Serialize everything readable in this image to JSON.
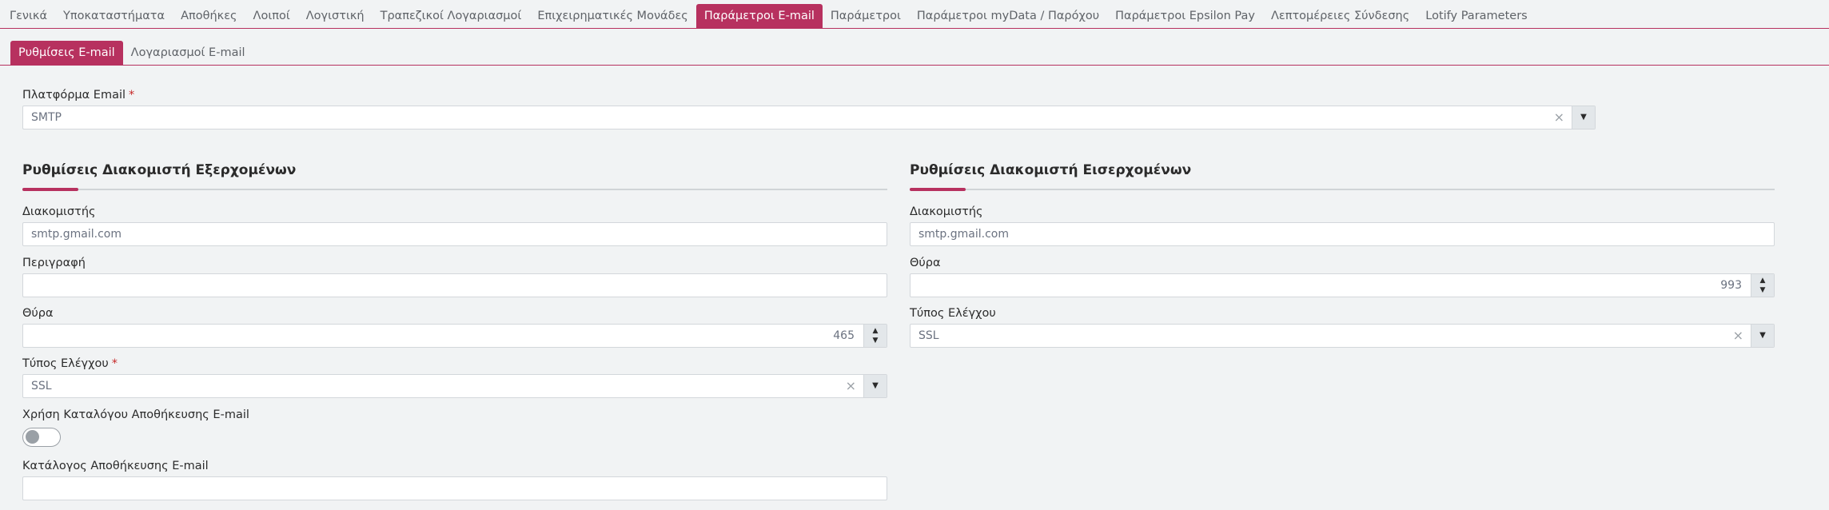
{
  "top_tabs": [
    {
      "label": "Γενικά"
    },
    {
      "label": "Υποκαταστήματα"
    },
    {
      "label": "Αποθήκες"
    },
    {
      "label": "Λοιποί"
    },
    {
      "label": "Λογιστική"
    },
    {
      "label": "Τραπεζικοί Λογαριασμοί"
    },
    {
      "label": "Επιχειρηματικές Μονάδες"
    },
    {
      "label": "Παράμετροι E-mail",
      "active": true
    },
    {
      "label": "Παράμετροι"
    },
    {
      "label": "Παράμετροι myData / Παρόχου"
    },
    {
      "label": "Παράμετροι Epsilon Pay"
    },
    {
      "label": "Λεπτομέρειες Σύνδεσης"
    },
    {
      "label": "Lotify Parameters"
    }
  ],
  "sub_tabs": [
    {
      "label": "Ρυθμίσεις E-mail",
      "active": true
    },
    {
      "label": "Λογαριασμοί E-mail"
    }
  ],
  "platform": {
    "label": "Πλατφόρμα Email",
    "required": "*",
    "value": "SMTP"
  },
  "outgoing": {
    "title": "Ρυθμίσεις Διακομιστή Εξερχομένων",
    "server_label": "Διακομιστής",
    "server_value": "smtp.gmail.com",
    "description_label": "Περιγραφή",
    "description_value": "",
    "port_label": "Θύρα",
    "port_value": "465",
    "auth_label": "Τύπος Ελέγχου",
    "auth_required": "*",
    "auth_value": "SSL",
    "use_folder_label": "Χρήση Καταλόγου Αποθήκευσης E-mail",
    "use_folder_on": false,
    "folder_label": "Κατάλογος Αποθήκευσης E-mail",
    "folder_value": ""
  },
  "incoming": {
    "title": "Ρυθμίσεις Διακομιστή Εισερχομένων",
    "server_label": "Διακομιστής",
    "server_value": "smtp.gmail.com",
    "port_label": "Θύρα",
    "port_value": "993",
    "auth_label": "Τύπος Ελέγχου",
    "auth_value": "SSL"
  },
  "icons": {
    "clear": "×",
    "dropdown": "▼",
    "spin_up": "▲",
    "spin_down": "▼"
  },
  "colors": {
    "accent": "#b7315f",
    "background": "#f1f3f4"
  }
}
